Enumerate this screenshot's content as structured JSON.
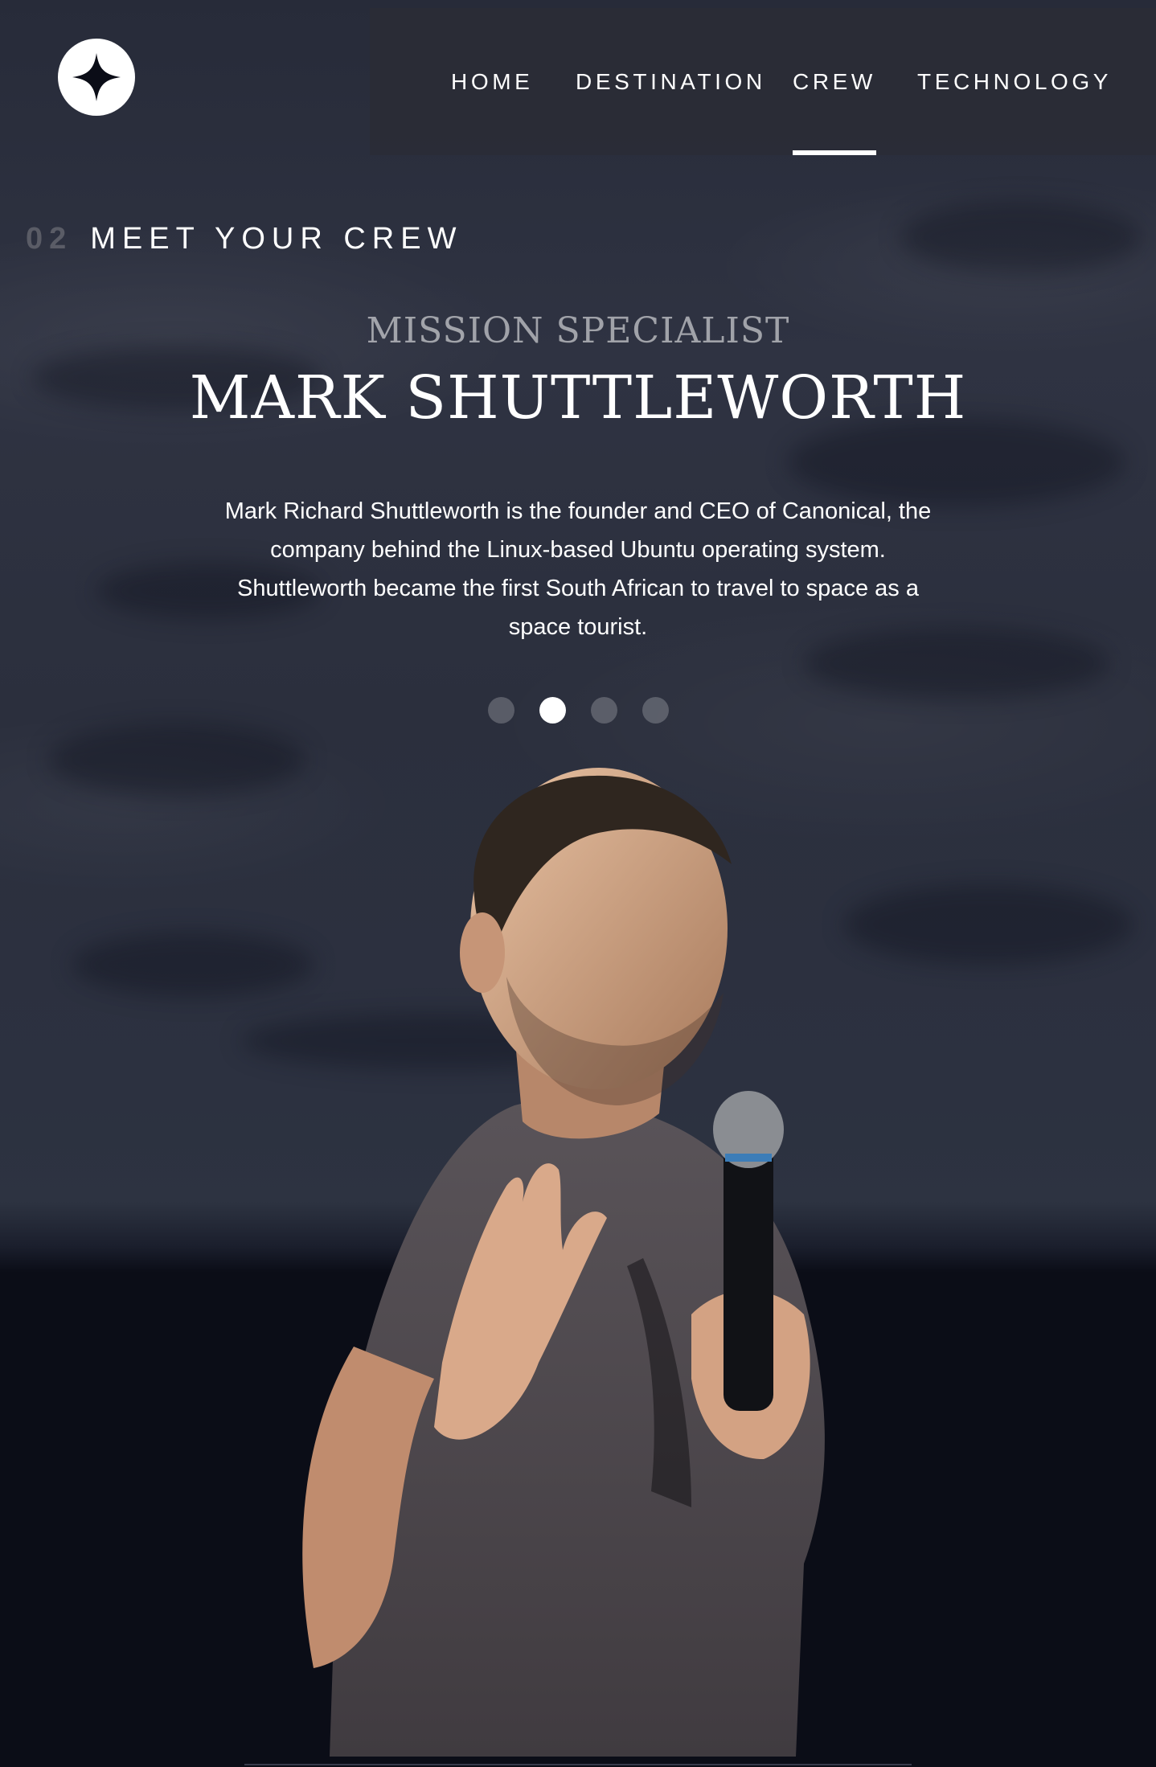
{
  "nav": {
    "items": [
      {
        "label": "HOME"
      },
      {
        "label": "DESTINATION"
      },
      {
        "label": "CREW",
        "active": true
      },
      {
        "label": "TECHNOLOGY"
      }
    ]
  },
  "heading": {
    "number": "02",
    "text": "MEET YOUR CREW"
  },
  "crew": {
    "role": "MISSION SPECIALIST",
    "name": "MARK SHUTTLEWORTH",
    "bio": "Mark Richard Shuttleworth is the founder and CEO of Canonical, the company behind the Linux-based Ubuntu operating system. Shuttleworth became the first South African to travel to space as a space tourist.",
    "pagination": {
      "count": 4,
      "active_index": 1
    }
  },
  "colors": {
    "background": "#0b0d17",
    "text": "#ffffff",
    "nav_background": "#2a2c36"
  },
  "icons": {
    "logo": "star-logo-icon"
  }
}
